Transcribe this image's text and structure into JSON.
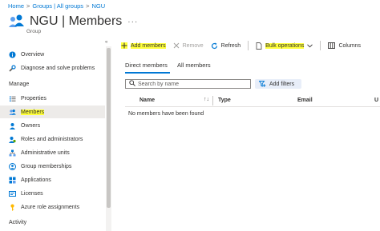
{
  "breadcrumb": [
    "Home",
    "Groups | All groups",
    "NGU"
  ],
  "header": {
    "title": "NGU | Members",
    "subtitle": "Group",
    "more_label": "···"
  },
  "sidebar": {
    "collapse_glyph": "«",
    "items_top": [
      {
        "label": "Overview",
        "icon": "info-icon"
      },
      {
        "label": "Diagnose and solve problems",
        "icon": "wrench-icon"
      }
    ],
    "section_manage": "Manage",
    "items_manage": [
      {
        "label": "Properties",
        "icon": "properties-icon"
      },
      {
        "label": "Members",
        "icon": "members-icon",
        "active": true
      },
      {
        "label": "Owners",
        "icon": "owners-icon"
      },
      {
        "label": "Roles and administrators",
        "icon": "roles-icon"
      },
      {
        "label": "Administrative units",
        "icon": "admin-units-icon"
      },
      {
        "label": "Group memberships",
        "icon": "group-memberships-icon"
      },
      {
        "label": "Applications",
        "icon": "applications-icon"
      },
      {
        "label": "Licenses",
        "icon": "licenses-icon"
      },
      {
        "label": "Azure role assignments",
        "icon": "key-icon"
      }
    ],
    "section_activity": "Activity"
  },
  "toolbar": {
    "add_members": "Add members",
    "remove": "Remove",
    "refresh": "Refresh",
    "bulk_operations": "Bulk operations",
    "columns": "Columns"
  },
  "tabs": [
    "Direct members",
    "All members"
  ],
  "search": {
    "placeholder": "Search by name"
  },
  "filters": {
    "label": "Add filters"
  },
  "table": {
    "columns": [
      "Name",
      "Type",
      "Email",
      "U"
    ],
    "empty_message": "No members have been found"
  },
  "colors": {
    "accent": "#0078d4",
    "highlight": "#ffff3a",
    "active_nav": "#edebe9"
  }
}
